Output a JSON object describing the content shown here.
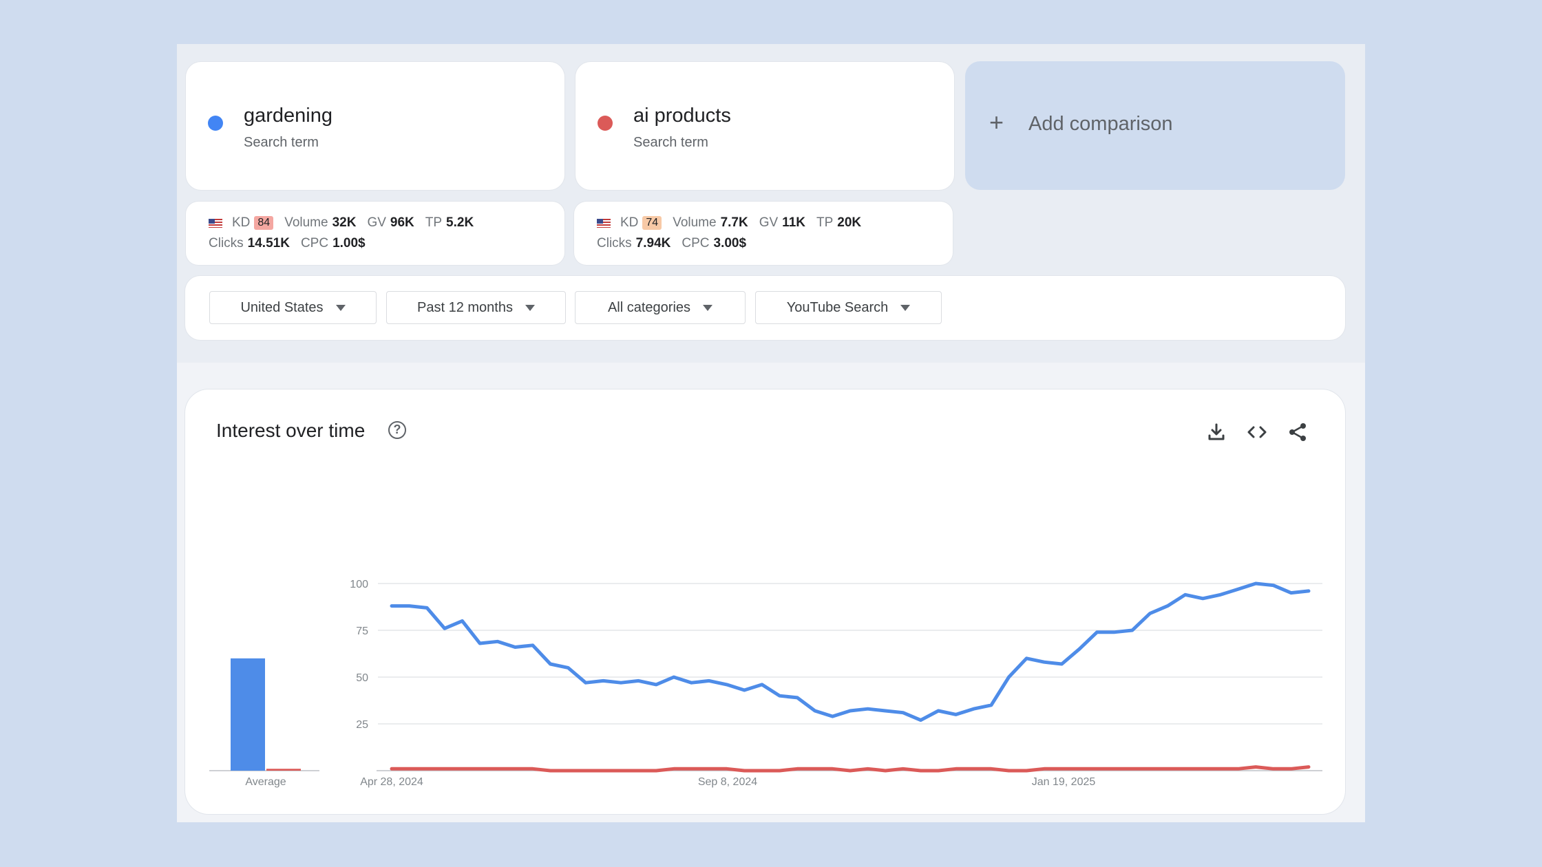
{
  "terms": [
    {
      "name": "gardening",
      "subtitle": "Search term",
      "color": "#4285f4"
    },
    {
      "name": "ai products",
      "subtitle": "Search term",
      "color": "#db5a58"
    }
  ],
  "add_comparison": {
    "label": "Add comparison",
    "icon": "plus-icon"
  },
  "metrics": [
    {
      "kd_label": "KD",
      "kd": "84",
      "kd_color": "#f4a7a1",
      "volume_label": "Volume",
      "volume": "32K",
      "gv_label": "GV",
      "gv": "96K",
      "tp_label": "TP",
      "tp": "5.2K",
      "clicks_label": "Clicks",
      "clicks": "14.51K",
      "cpc_label": "CPC",
      "cpc": "1.00$"
    },
    {
      "kd_label": "KD",
      "kd": "74",
      "kd_color": "#f7c9a6",
      "volume_label": "Volume",
      "volume": "7.7K",
      "gv_label": "GV",
      "gv": "11K",
      "tp_label": "TP",
      "tp": "20K",
      "clicks_label": "Clicks",
      "clicks": "7.94K",
      "cpc_label": "CPC",
      "cpc": "3.00$"
    }
  ],
  "filters": [
    {
      "label": "United States"
    },
    {
      "label": "Past 12 months"
    },
    {
      "label": "All categories"
    },
    {
      "label": "YouTube Search"
    }
  ],
  "interest": {
    "title": "Interest over time",
    "icons": [
      "help-icon",
      "download-icon",
      "embed-code-icon",
      "share-icon"
    ]
  },
  "chart_data": {
    "type": "line",
    "title": "Interest over time",
    "x_tick_labels": [
      "Apr 28, 2024",
      "Sep 8, 2024",
      "Jan 19, 2025"
    ],
    "y_ticks": [
      25,
      50,
      75,
      100
    ],
    "ylim": [
      0,
      100
    ],
    "grid": true,
    "average_label": "Average",
    "averages": [
      {
        "series": "gardening",
        "value": 60
      },
      {
        "series": "ai products",
        "value": 1
      }
    ],
    "series": [
      {
        "name": "gardening",
        "color": "#4e8ce8",
        "values": [
          88,
          88,
          87,
          76,
          80,
          68,
          69,
          66,
          67,
          57,
          55,
          47,
          48,
          47,
          48,
          46,
          50,
          47,
          48,
          46,
          43,
          46,
          40,
          39,
          32,
          29,
          32,
          33,
          32,
          31,
          27,
          32,
          30,
          33,
          35,
          50,
          60,
          58,
          57,
          65,
          74,
          74,
          75,
          84,
          88,
          94,
          92,
          94,
          97,
          100,
          99,
          95,
          96
        ]
      },
      {
        "name": "ai products",
        "color": "#db5a58",
        "values": [
          1,
          1,
          1,
          1,
          1,
          1,
          1,
          1,
          1,
          0,
          0,
          0,
          0,
          0,
          0,
          0,
          1,
          1,
          1,
          1,
          0,
          0,
          0,
          1,
          1,
          1,
          0,
          1,
          0,
          1,
          0,
          0,
          1,
          1,
          1,
          0,
          0,
          1,
          1,
          1,
          1,
          1,
          1,
          1,
          1,
          1,
          1,
          1,
          1,
          2,
          1,
          1,
          2
        ]
      }
    ]
  }
}
